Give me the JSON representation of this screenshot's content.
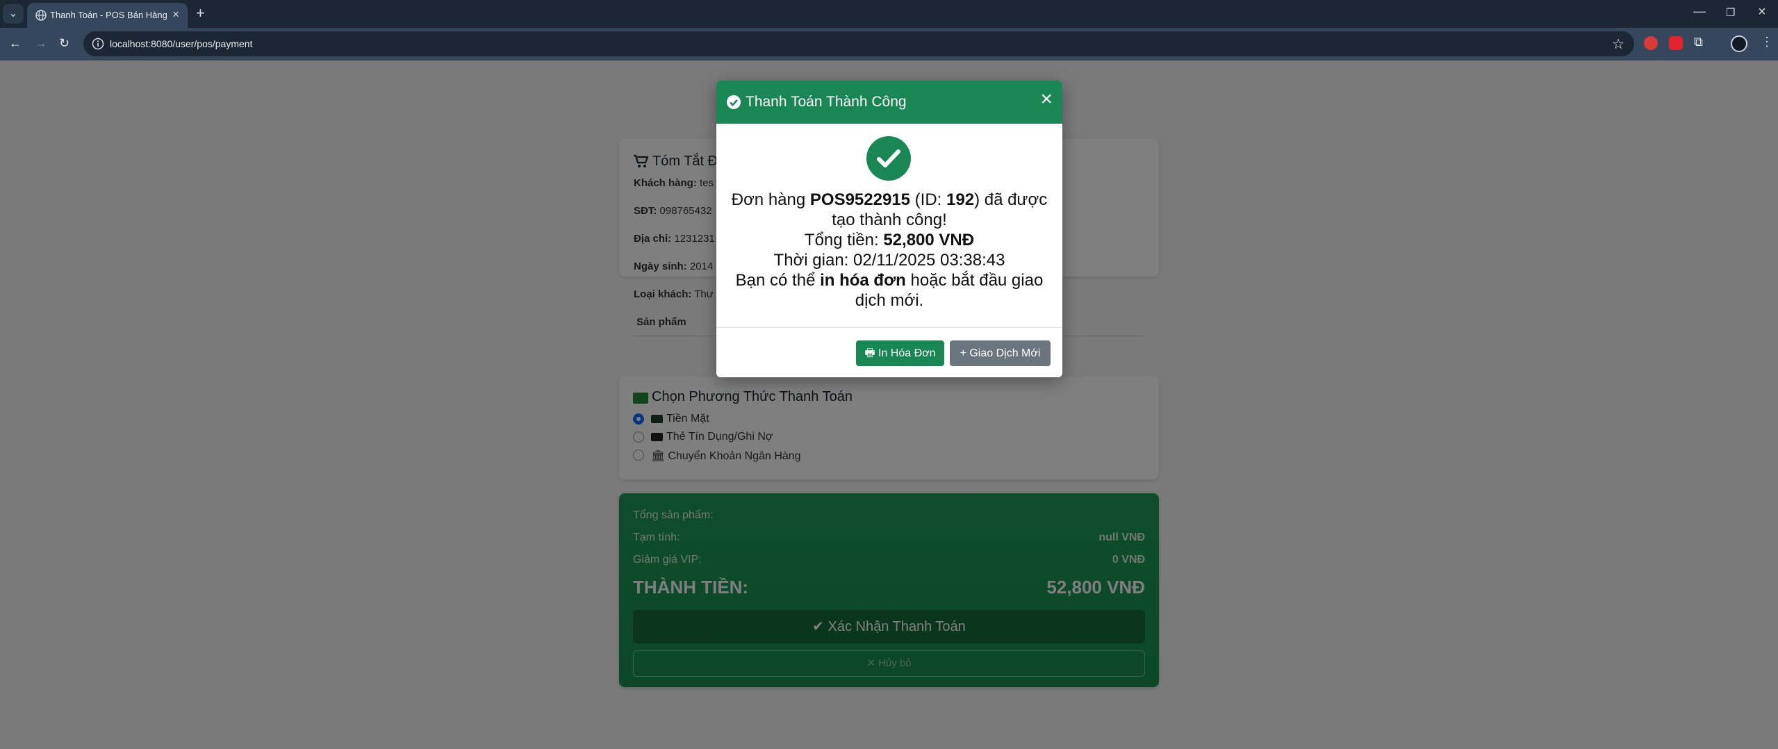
{
  "browser": {
    "tab_title": "Thanh Toán - POS Bán Hàng",
    "url": "localhost:8080/user/pos/payment"
  },
  "summary": {
    "title": "Tóm Tắt Đ",
    "customer_label": "Khách hàng:",
    "customer_value": "tes",
    "phone_label": "SĐT:",
    "phone_value": "098765432",
    "address_label": "Địa chỉ:",
    "address_value": "1231231",
    "dob_label": "Ngày sinh:",
    "dob_value": "2014",
    "type_label": "Loại khách:",
    "type_value": "Thư",
    "products_header": "Sản phẩm"
  },
  "payment": {
    "title": "Chọn Phương Thức Thanh Toán",
    "options": [
      {
        "label": "Tiền Mặt",
        "selected": true
      },
      {
        "label": "Thẻ Tín Dụng/Ghi Nợ",
        "selected": false
      },
      {
        "label": "Chuyển Khoản Ngân Hàng",
        "selected": false
      }
    ]
  },
  "totals": {
    "products_label": "Tổng sản phẩm:",
    "subtotal_label": "Tạm tính:",
    "subtotal_value": "null VNĐ",
    "vip_label": "Giảm giá VIP:",
    "vip_value": "0 VNĐ",
    "grand_label": "THÀNH TIỀN:",
    "grand_value": "52,800 VNĐ",
    "confirm_label": "Xác Nhận Thanh Toán",
    "cancel_label": "Hủy bỏ"
  },
  "modal": {
    "title": "Thanh Toán Thành Công",
    "line1_prefix": "Đơn hàng ",
    "order_code": "POS9522915",
    "line1_mid": " (ID: ",
    "order_id": "192",
    "line1_suffix": ") đã được tạo thành công!",
    "total_prefix": "Tổng tiền: ",
    "total_value": "52,800 VNĐ",
    "time_text": "Thời gian: 02/11/2025 03:38:43",
    "hint_prefix": "Bạn có thể ",
    "hint_bold": "in hóa đơn",
    "hint_suffix": " hoặc bắt đầu giao dịch mới.",
    "print_label": "In Hóa Đơn",
    "new_label": "Giao Dịch Mới"
  },
  "colors": {
    "success": "#198754",
    "secondary": "#6c757d",
    "primary": "#0d6efd"
  }
}
